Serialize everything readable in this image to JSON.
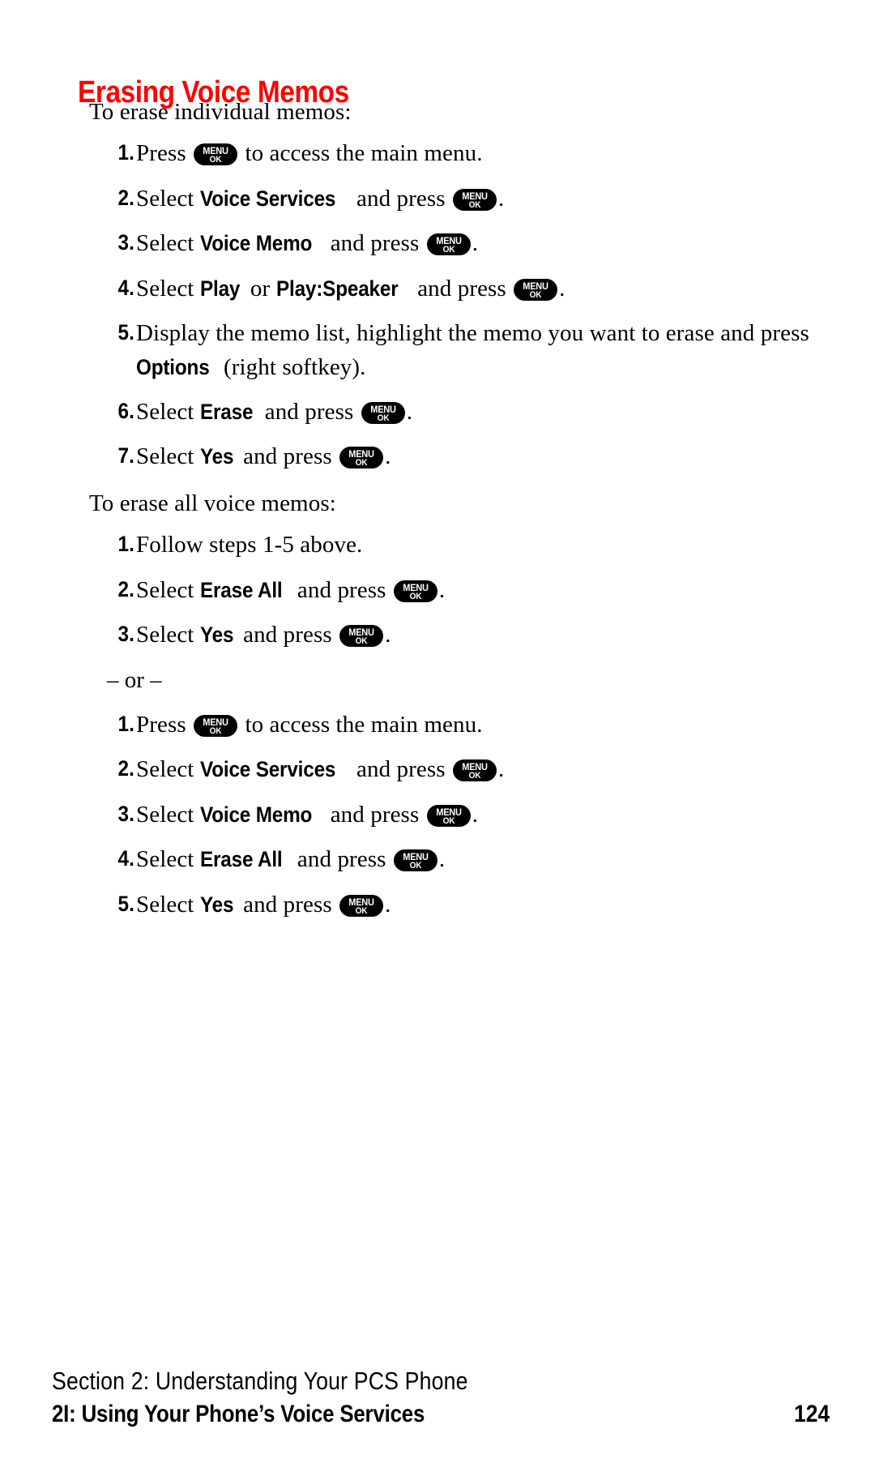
{
  "document": {
    "title": "Erasing Voice Memos",
    "title_color": "#FF0000",
    "page_number": "124"
  },
  "key_glyph": {
    "line1": "MENU",
    "line2": "OK",
    "background": "#000000",
    "foreground": "#FFFFFF"
  },
  "section_individual": {
    "lead": "To erase individual memos:",
    "steps": [
      {
        "num": "1.",
        "parts": [
          {
            "t": "text",
            "v": "Press "
          },
          {
            "t": "key"
          },
          {
            "t": "text",
            "v": " to access the main menu."
          }
        ]
      },
      {
        "num": "2.",
        "parts": [
          {
            "t": "text",
            "v": "Select "
          },
          {
            "t": "strong",
            "v": "Voice Services"
          },
          {
            "t": "text",
            "v": " and press "
          },
          {
            "t": "key"
          },
          {
            "t": "text",
            "v": "."
          }
        ]
      },
      {
        "num": "3.",
        "parts": [
          {
            "t": "text",
            "v": "Select "
          },
          {
            "t": "strong",
            "v": "Voice Memo"
          },
          {
            "t": "text",
            "v": " and press "
          },
          {
            "t": "key"
          },
          {
            "t": "text",
            "v": "."
          }
        ]
      },
      {
        "num": "4.",
        "parts": [
          {
            "t": "text",
            "v": "Select "
          },
          {
            "t": "strong",
            "v": "Play"
          },
          {
            "t": "text",
            "v": " or "
          },
          {
            "t": "strong",
            "v": "Play:Speaker"
          },
          {
            "t": "text",
            "v": " and press "
          },
          {
            "t": "key"
          },
          {
            "t": "text",
            "v": "."
          }
        ]
      },
      {
        "num": "5.",
        "parts": [
          {
            "t": "text",
            "v": "Display the memo list, highlight the memo you want to erase and press "
          },
          {
            "t": "strong",
            "v": "Options"
          },
          {
            "t": "text",
            "v": " (right softkey)."
          }
        ]
      },
      {
        "num": "6.",
        "parts": [
          {
            "t": "text",
            "v": "Select "
          },
          {
            "t": "strong",
            "v": "Erase"
          },
          {
            "t": "text",
            "v": " and press "
          },
          {
            "t": "key"
          },
          {
            "t": "text",
            "v": "."
          }
        ]
      },
      {
        "num": "7.",
        "parts": [
          {
            "t": "text",
            "v": "Select "
          },
          {
            "t": "strong",
            "v": "Yes"
          },
          {
            "t": "text",
            "v": " and press "
          },
          {
            "t": "key"
          },
          {
            "t": "text",
            "v": "."
          }
        ]
      }
    ]
  },
  "section_all": {
    "lead": "To erase all voice memos:",
    "steps": [
      {
        "num": "1.",
        "parts": [
          {
            "t": "text",
            "v": "Follow steps 1-5 above."
          }
        ]
      },
      {
        "num": "2.",
        "parts": [
          {
            "t": "text",
            "v": "Select "
          },
          {
            "t": "strong",
            "v": "Erase All"
          },
          {
            "t": "text",
            "v": " and press "
          },
          {
            "t": "key"
          },
          {
            "t": "text",
            "v": "."
          }
        ]
      },
      {
        "num": "3.",
        "parts": [
          {
            "t": "text",
            "v": "Select "
          },
          {
            "t": "strong",
            "v": "Yes"
          },
          {
            "t": "text",
            "v": " and press "
          },
          {
            "t": "key"
          },
          {
            "t": "text",
            "v": "."
          }
        ]
      }
    ],
    "divider": "– or –",
    "alt_steps": [
      {
        "num": "1.",
        "parts": [
          {
            "t": "text",
            "v": "Press "
          },
          {
            "t": "key"
          },
          {
            "t": "text",
            "v": " to access the main menu."
          }
        ]
      },
      {
        "num": "2.",
        "parts": [
          {
            "t": "text",
            "v": "Select "
          },
          {
            "t": "strong",
            "v": "Voice Services"
          },
          {
            "t": "text",
            "v": " and press "
          },
          {
            "t": "key"
          },
          {
            "t": "text",
            "v": "."
          }
        ]
      },
      {
        "num": "3.",
        "parts": [
          {
            "t": "text",
            "v": "Select "
          },
          {
            "t": "strong",
            "v": "Voice Memo"
          },
          {
            "t": "text",
            "v": " and press "
          },
          {
            "t": "key"
          },
          {
            "t": "text",
            "v": "."
          }
        ]
      },
      {
        "num": "4.",
        "parts": [
          {
            "t": "text",
            "v": "Select "
          },
          {
            "t": "strong",
            "v": "Erase All"
          },
          {
            "t": "text",
            "v": " and press "
          },
          {
            "t": "key"
          },
          {
            "t": "text",
            "v": "."
          }
        ]
      },
      {
        "num": "5.",
        "parts": [
          {
            "t": "text",
            "v": "Select "
          },
          {
            "t": "strong",
            "v": "Yes"
          },
          {
            "t": "text",
            "v": " and press "
          },
          {
            "t": "key"
          },
          {
            "t": "text",
            "v": "."
          }
        ]
      }
    ]
  },
  "footer": {
    "line1": "Section 2: Understanding Your PCS Phone",
    "line2": "2I: Using Your Phone’s Voice Services"
  }
}
